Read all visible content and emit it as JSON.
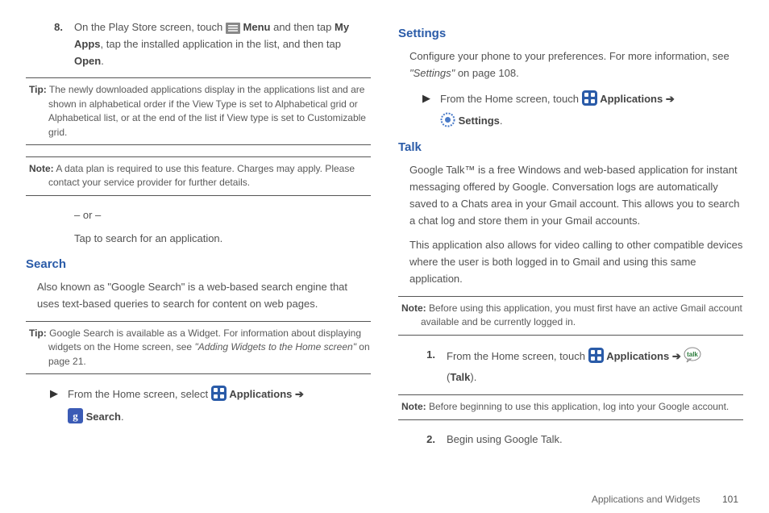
{
  "left": {
    "step8_num": "8.",
    "step8_a": "On the Play Store screen, touch ",
    "step8_menu": "Menu",
    "step8_b": " and then tap ",
    "step8_myapps": "My Apps",
    "step8_c": ", tap the installed application in the list, and then tap ",
    "step8_open": "Open",
    "step8_d": ".",
    "tip1_lead": "Tip:",
    "tip1_body": " The newly downloaded applications display in the applications list and are shown in alphabetical order if the View Type is set to Alphabetical grid or Alphabetical list, or at the end of the list if View type is set to Customizable grid.",
    "note1_lead": "Note:",
    "note1_body": "  A data plan is required to use this feature. Charges may apply. Please contact your service provider for further details.",
    "or": "– or –",
    "tap_search": "Tap to search for an application.",
    "search_h": "Search",
    "search_p": "Also known as \"Google Search\" is a web-based search engine that uses text-based queries to search for content on web pages.",
    "tip2_lead": "Tip:",
    "tip2_a": " Google Search is available as a Widget. For information about displaying widgets on the Home screen, see ",
    "tip2_i": "\"Adding Widgets to the Home screen\"",
    "tip2_b": " on page 21.",
    "arrow1_a": "From the Home screen, select ",
    "arrow1_apps": "Applications ➔",
    "arrow1_search": "Search",
    "arrow1_dot": "."
  },
  "right": {
    "settings_h": "Settings",
    "settings_a": "Configure your phone to your preferences. For more information, see ",
    "settings_i": "\"Settings\"",
    "settings_b": " on page 108.",
    "arrow2_a": "From the Home screen, touch ",
    "arrow2_apps": "Applications ➔",
    "arrow2_settings": "Settings",
    "arrow2_dot": ".",
    "talk_h": "Talk",
    "talk_p1": "Google Talk™ is a free Windows and web-based application for instant messaging offered by Google. Conversation logs are automatically saved to a Chats area in your Gmail account. This allows you to search a chat log and store them in your Gmail accounts.",
    "talk_p2": "This application also allows for video calling to other compatible devices where the user is both logged in to Gmail and using this same application.",
    "note2_lead": "Note:",
    "note2_body": " Before using this application, you must first have an active Gmail account available and be currently logged in.",
    "step1_num": "1.",
    "step1_a": "From the Home screen, touch ",
    "step1_apps": "Applications ➔",
    "step1_talk": "Talk",
    "step1_b": "(",
    "step1_c": ").",
    "note3_lead": "Note:",
    "note3_body": " Before beginning to use this application, log into your Google account.",
    "step2_num": "2.",
    "step2_body": "Begin using Google Talk.",
    "footer_label": "Applications and Widgets",
    "footer_page": "101"
  }
}
